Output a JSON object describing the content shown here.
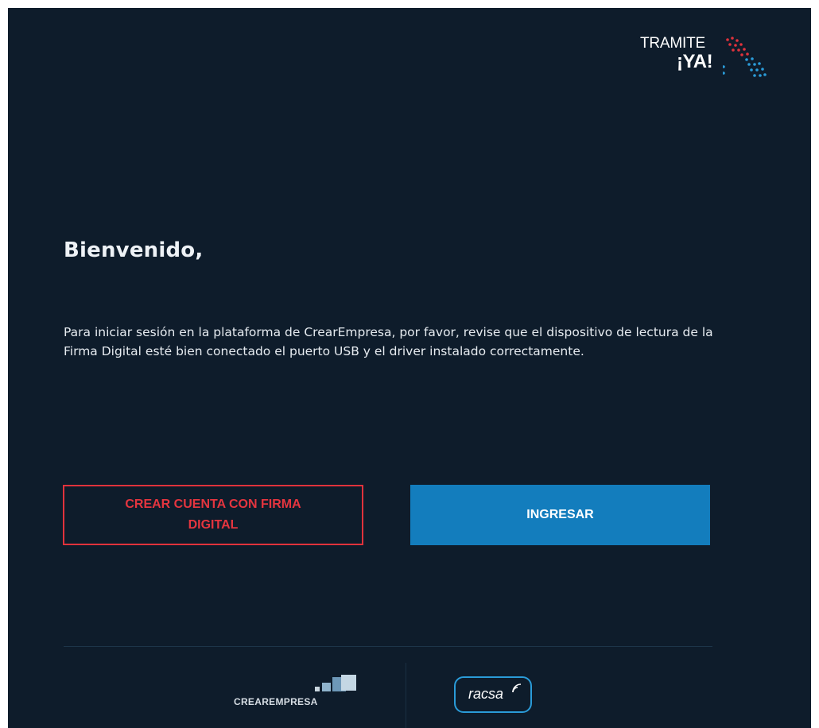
{
  "brand": {
    "line1": "TRAMITE",
    "line2": "¡YA!",
    "dot_colors": [
      "#e0323c",
      "#2a9bd8"
    ]
  },
  "main": {
    "heading": "Bienvenido,",
    "intro": "Para iniciar sesión en la plataforma de CrearEmpresa, por favor, revise que el dispositivo de lectura de la Firma Digital esté bien conectado el puerto USB y el driver instalado correctamente."
  },
  "actions": {
    "create_account_label": "CREAR CUENTA CON FIRMA DIGITAL",
    "login_label": "INGRESAR"
  },
  "footer": {
    "crearempresa_label": "CREAREMPRESA",
    "racsa_label": "racsa"
  },
  "colors": {
    "background": "#0e1c2b",
    "primary": "#137dbd",
    "danger": "#e0323c"
  }
}
